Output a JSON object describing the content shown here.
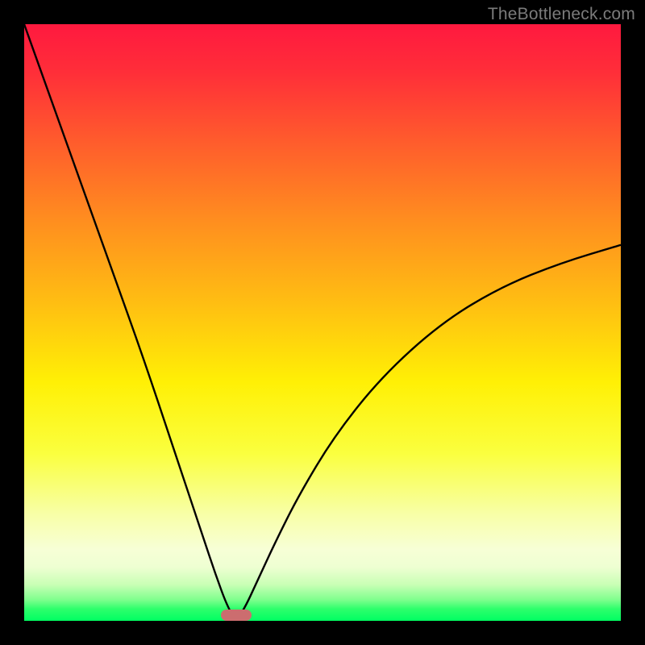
{
  "watermark": "TheBottleneck.com",
  "marker": {
    "x_fraction": 0.355
  },
  "chart_data": {
    "type": "line",
    "title": "",
    "xlabel": "",
    "ylabel": "",
    "xlim": [
      0,
      100
    ],
    "ylim": [
      0,
      100
    ],
    "grid": false,
    "legend": false,
    "description": "Bottleneck-style V curve on rainbow gradient. Minimum (optimal point) at x≈35.5%, y≈0. Left branch rises to ~100 at x=0; right branch rises to ~63 at x=100.",
    "x": [
      0,
      5,
      10,
      15,
      20,
      25,
      28,
      30,
      32,
      34,
      35.5,
      37,
      39,
      42,
      46,
      52,
      60,
      70,
      80,
      90,
      100
    ],
    "values": [
      100,
      86,
      72,
      58,
      44,
      29,
      20,
      14,
      8,
      2.5,
      0,
      2.2,
      6.5,
      13,
      21,
      31,
      41,
      50,
      56,
      60,
      63
    ],
    "series": [
      {
        "name": "bottleneck-curve",
        "stroke": "#000000",
        "width": 2.4
      }
    ],
    "background_gradient_stops": [
      {
        "pos": 0.0,
        "color": "#ff193f"
      },
      {
        "pos": 0.2,
        "color": "#ff5d2c"
      },
      {
        "pos": 0.47,
        "color": "#ffbf12"
      },
      {
        "pos": 0.72,
        "color": "#faff3f"
      },
      {
        "pos": 0.88,
        "color": "#f7ffd6"
      },
      {
        "pos": 0.96,
        "color": "#7dff8d"
      },
      {
        "pos": 1.0,
        "color": "#00ff62"
      }
    ]
  }
}
